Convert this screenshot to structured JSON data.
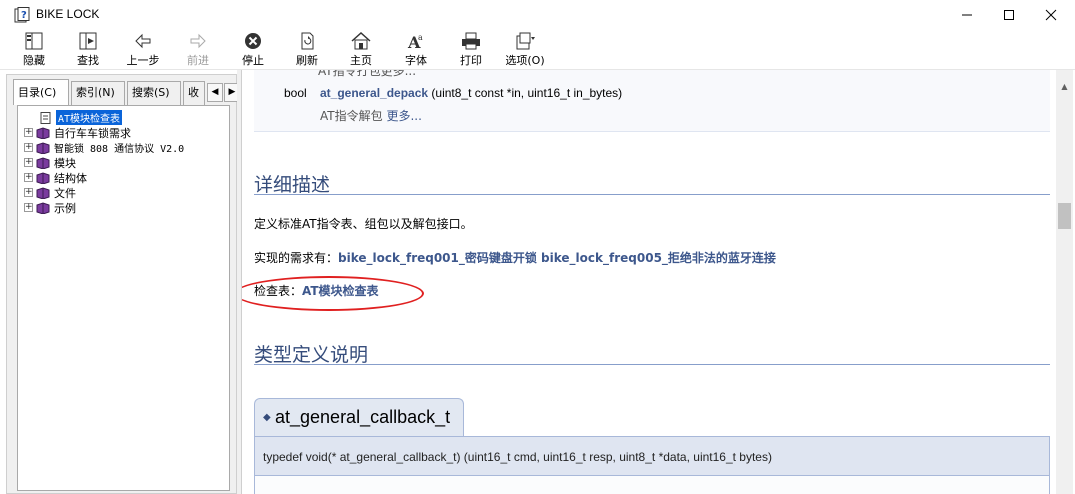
{
  "window": {
    "title": "BIKE LOCK",
    "controls": {
      "minimize": "—",
      "maximize": "☐",
      "close": "✕"
    }
  },
  "toolbar": {
    "buttons": [
      {
        "label": "隐藏",
        "icon": "hide-icon",
        "enabled": true
      },
      {
        "label": "查找",
        "icon": "locate-icon",
        "enabled": true
      },
      {
        "label": "上一步",
        "icon": "back-icon",
        "enabled": true
      },
      {
        "label": "前进",
        "icon": "forward-icon",
        "enabled": false
      },
      {
        "label": "停止",
        "icon": "stop-icon",
        "enabled": true
      },
      {
        "label": "刷新",
        "icon": "refresh-icon",
        "enabled": true
      },
      {
        "label": "主页",
        "icon": "home-icon",
        "enabled": true
      },
      {
        "label": "字体",
        "icon": "font-icon",
        "enabled": true
      },
      {
        "label": "打印",
        "icon": "print-icon",
        "enabled": true
      },
      {
        "label": "选项(O)",
        "icon": "options-icon",
        "enabled": true
      }
    ]
  },
  "sidebar": {
    "tabs": [
      {
        "label": "目录(C)",
        "active": true
      },
      {
        "label": "索引(N)",
        "active": false
      },
      {
        "label": "搜索(S)",
        "active": false
      },
      {
        "label": "收",
        "active": false
      }
    ],
    "tree": [
      {
        "label": "AT模块检查表",
        "selected": true,
        "expander": "",
        "icon": "page-icon"
      },
      {
        "label": "自行车车锁需求",
        "selected": false,
        "expander": "+",
        "icon": "book-icon"
      },
      {
        "label": "智能锁 808 通信协议 V2.0",
        "selected": false,
        "expander": "+",
        "icon": "book-icon"
      },
      {
        "label": "模块",
        "selected": false,
        "expander": "+",
        "icon": "book-icon"
      },
      {
        "label": "结构体",
        "selected": false,
        "expander": "+",
        "icon": "book-icon"
      },
      {
        "label": "文件",
        "selected": false,
        "expander": "+",
        "icon": "book-icon"
      },
      {
        "label": "示例",
        "selected": false,
        "expander": "+",
        "icon": "book-icon"
      }
    ]
  },
  "content": {
    "partial_text": "AT指令打包更多...",
    "member": {
      "type": "bool",
      "name": "at_general_depack",
      "args": " (uint8_t const *in, uint16_t in_bytes)",
      "brief": "AT指令解包 ",
      "more": "更多..."
    },
    "section_detail": "详细描述",
    "description": "定义标准AT指令表、组包以及解包接口。",
    "requirements_label": "实现的需求有：",
    "requirements_link": "bike_lock_freq001_密码键盘开锁 bike_lock_freq005_拒绝非法的蓝牙连接",
    "checklist_label": "检查表：",
    "checklist_link": "AT模块检查表",
    "section_typedef": "类型定义说明",
    "typedef_title": "at_general_callback_t",
    "typedef_proto": "typedef void(* at_general_callback_t) (uint16_t cmd, uint16_t resp, uint8_t *data, uint16_t bytes)"
  },
  "colors": {
    "link": "#3d578c",
    "heading": "#354c7b",
    "highlight_ellipse": "#e02020",
    "selection": "#0a64d9"
  }
}
